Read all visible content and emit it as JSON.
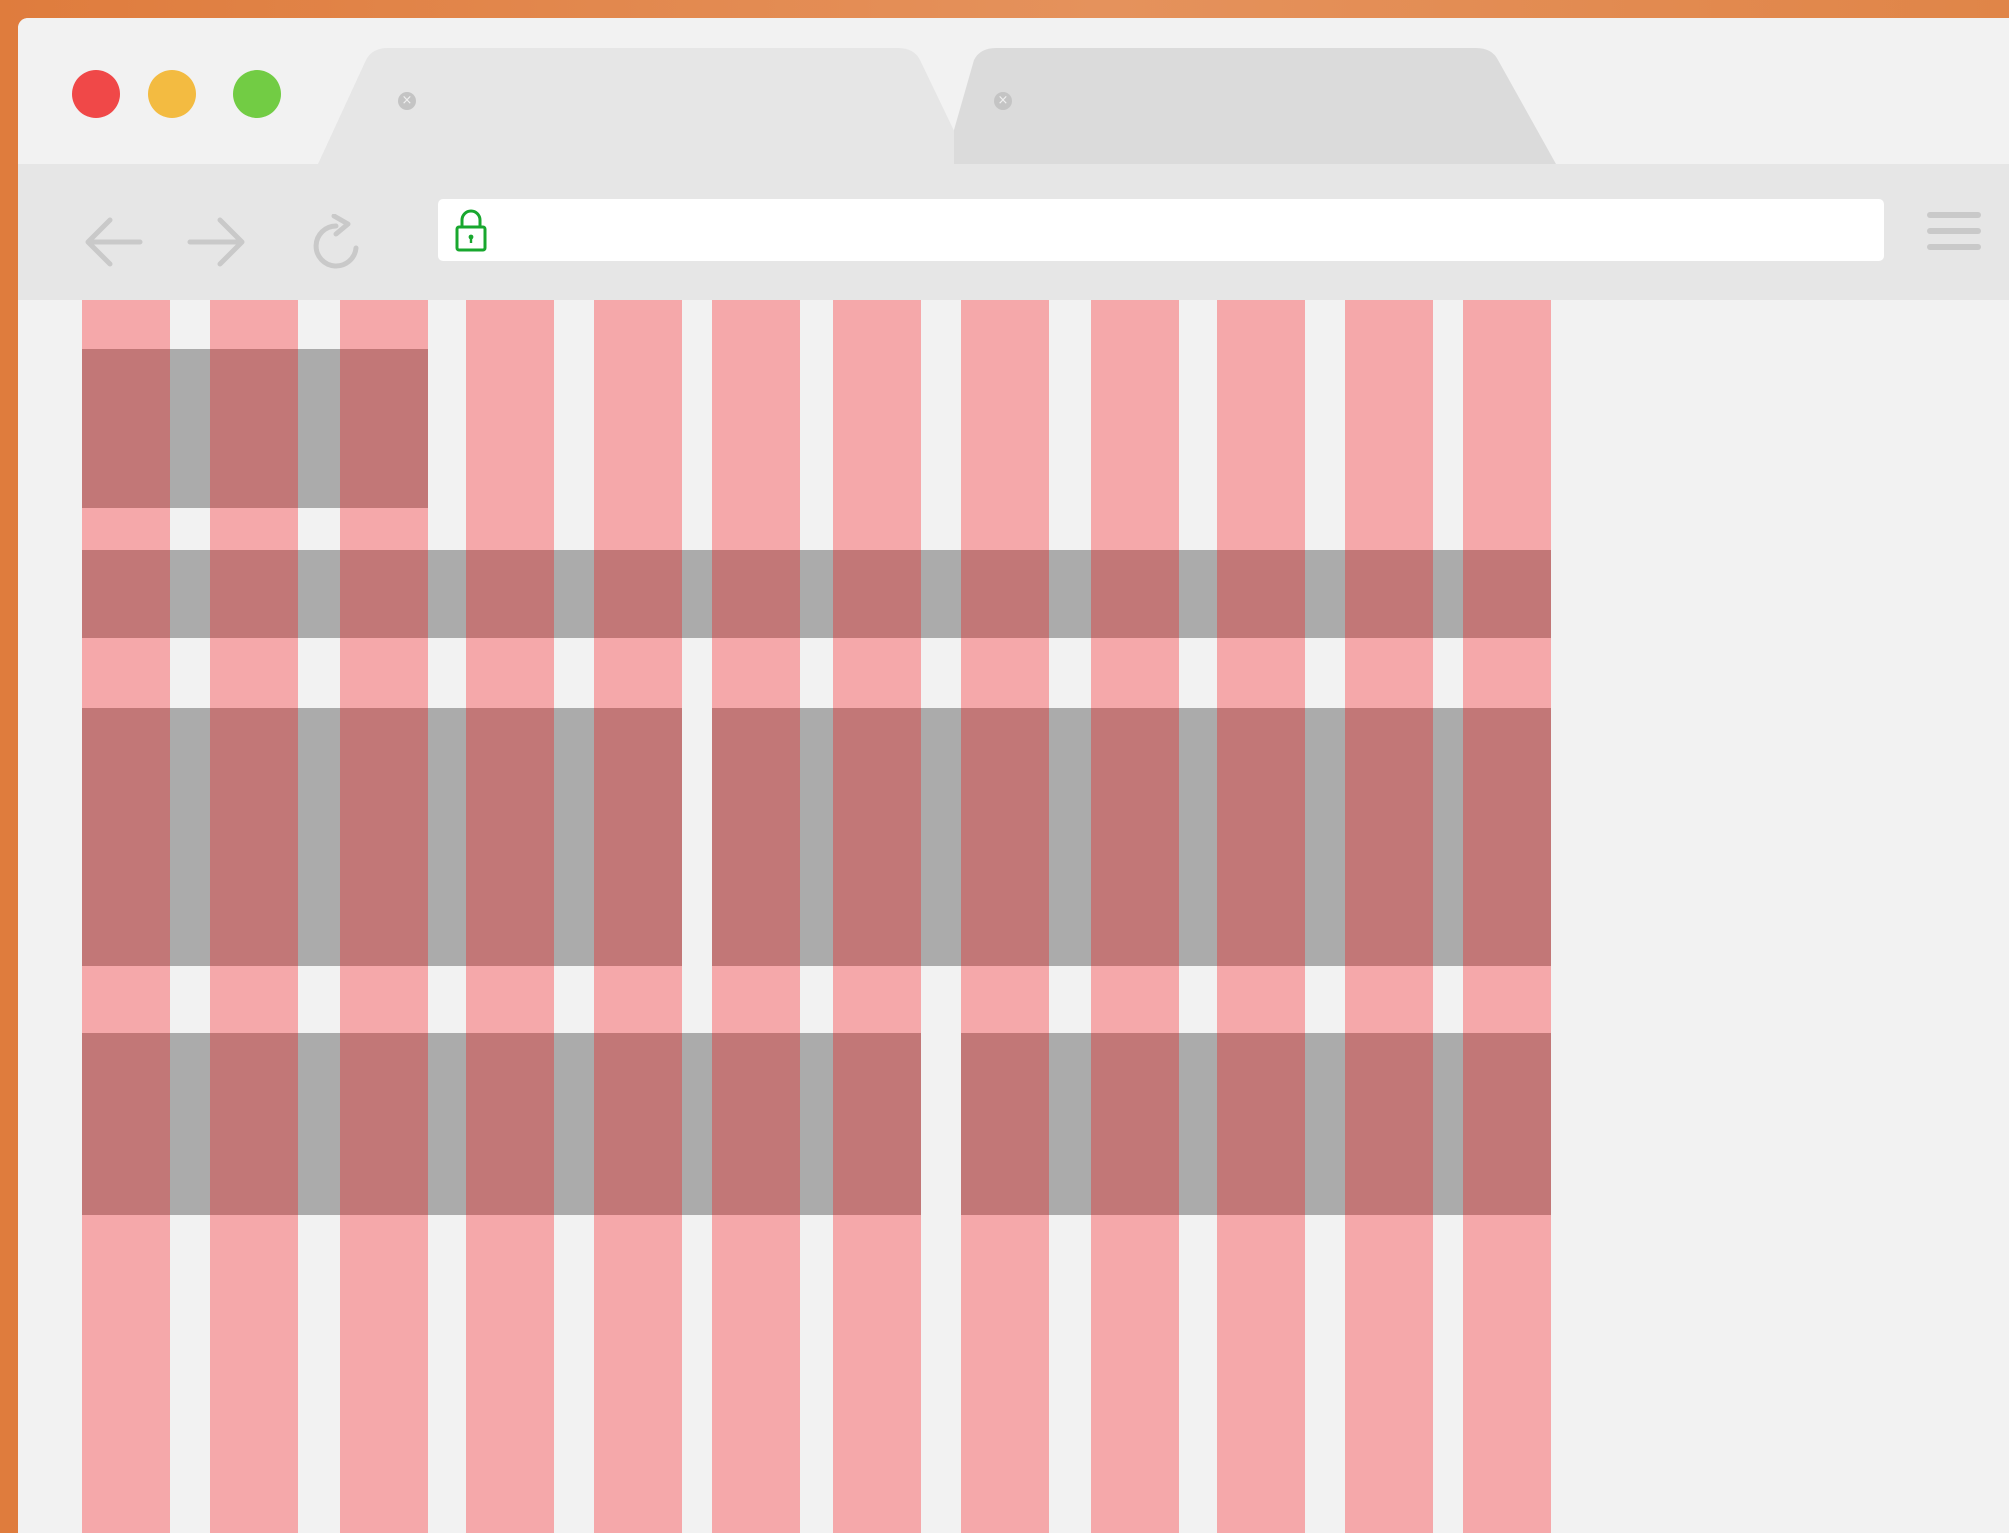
{
  "window": {
    "traffic_lights": {
      "close": "#f04848",
      "minimize": "#f3bb41",
      "maximize": "#72cc44"
    }
  },
  "tabs": [
    {
      "title": "",
      "active": true,
      "close_icon": "close-icon"
    },
    {
      "title": "",
      "active": false,
      "close_icon": "close-icon"
    }
  ],
  "toolbar": {
    "back_icon": "arrow-left-icon",
    "forward_icon": "arrow-right-icon",
    "reload_icon": "reload-icon",
    "menu_icon": "hamburger-menu-icon",
    "address": {
      "value": "",
      "placeholder": "",
      "secure": true,
      "lock_icon": "lock-icon",
      "lock_color": "#18a72e"
    }
  },
  "grid_overlay": {
    "columns": 12,
    "column_color": "#f5a8aa",
    "row_color": "#c27777",
    "gutter_color": "#ababab",
    "rows": [
      {
        "label": "row-1",
        "spans": [
          {
            "from": 1,
            "to": 3
          }
        ]
      },
      {
        "label": "row-2",
        "spans": [
          {
            "from": 1,
            "to": 12
          }
        ]
      },
      {
        "label": "row-3",
        "spans": [
          {
            "from": 1,
            "to": 5
          },
          {
            "from": 6,
            "to": 12
          }
        ]
      },
      {
        "label": "row-4",
        "spans": [
          {
            "from": 1,
            "to": 7
          },
          {
            "from": 8,
            "to": 12
          }
        ]
      }
    ]
  }
}
